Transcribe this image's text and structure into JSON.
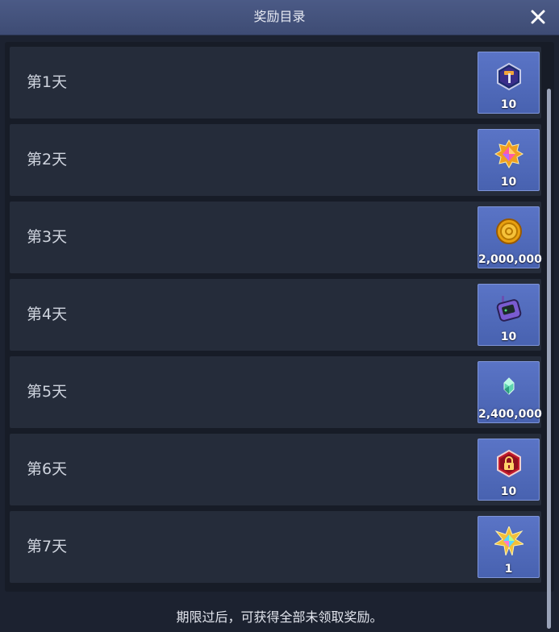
{
  "title": "奖励目录",
  "rows": [
    {
      "label": "第1天",
      "icon": "hammer-gem-icon",
      "quantity": "10"
    },
    {
      "label": "第2天",
      "icon": "star-crystal-icon",
      "quantity": "10"
    },
    {
      "label": "第3天",
      "icon": "gold-coin-icon",
      "quantity": "2,000,000"
    },
    {
      "label": "第4天",
      "icon": "walkie-talkie-icon",
      "quantity": "10"
    },
    {
      "label": "第5天",
      "icon": "green-crystal-icon",
      "quantity": "2,400,000"
    },
    {
      "label": "第6天",
      "icon": "red-lock-gem-icon",
      "quantity": "10"
    },
    {
      "label": "第7天",
      "icon": "rainbow-star-icon",
      "quantity": "1"
    }
  ],
  "footer": "期限过后，可获得全部未领取奖励。",
  "colors": {
    "titlebar": "#4b5a86",
    "reward_bg": "#5a74c6",
    "row_bg": "#252c3a"
  }
}
